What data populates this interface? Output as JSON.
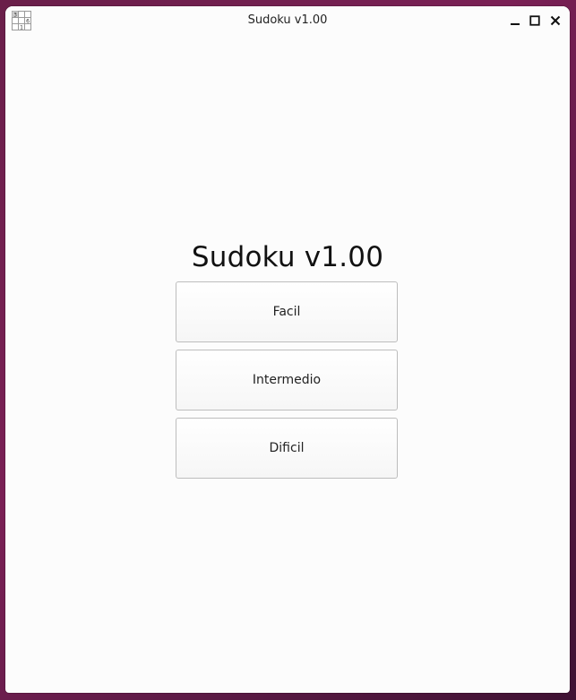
{
  "window": {
    "title": "Sudoku v1.00",
    "icon": "sudoku-grid-icon"
  },
  "icon_digits": [
    "3",
    "6",
    "1"
  ],
  "controls": {
    "minimize": "minimize-icon",
    "maximize": "maximize-icon",
    "close": "close-icon"
  },
  "main": {
    "title": "Sudoku v1.00",
    "buttons": [
      {
        "label": "Facil"
      },
      {
        "label": "Intermedio"
      },
      {
        "label": "Dificil"
      }
    ]
  },
  "colors": {
    "desktop": "#6a1f4a",
    "window_bg": "#fcfcfc",
    "button_border": "#bdbdbd"
  }
}
